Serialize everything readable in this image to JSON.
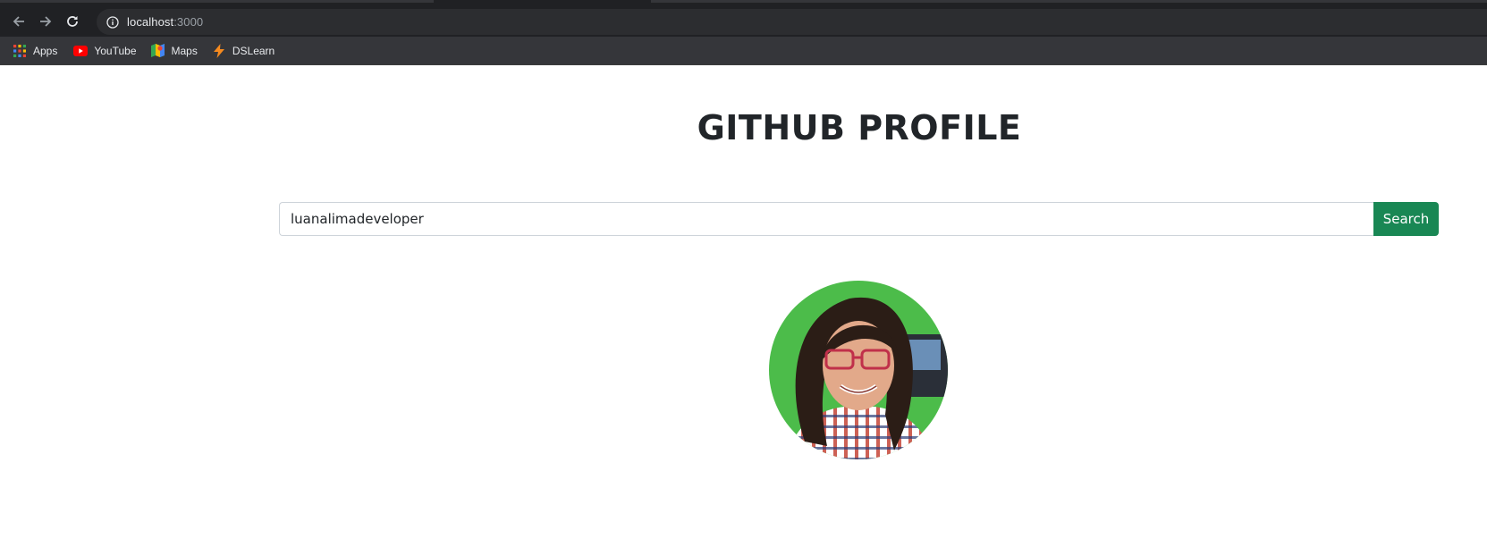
{
  "browser": {
    "url_host": "localhost",
    "url_port": ":3000",
    "bookmarks": [
      {
        "label": "Apps",
        "icon": "apps-grid-icon"
      },
      {
        "label": "YouTube",
        "icon": "youtube-icon"
      },
      {
        "label": "Maps",
        "icon": "maps-icon"
      },
      {
        "label": "DSLearn",
        "icon": "lightning-bolt-icon"
      }
    ]
  },
  "page": {
    "title": "GITHUB PROFILE",
    "search": {
      "value": "luanalimadeveloper",
      "button_label": "Search"
    },
    "avatar": {
      "icon": "profile-photo",
      "background_color": "#4cbc4a"
    }
  },
  "colors": {
    "button_green": "#198754",
    "title_text": "#212529"
  }
}
